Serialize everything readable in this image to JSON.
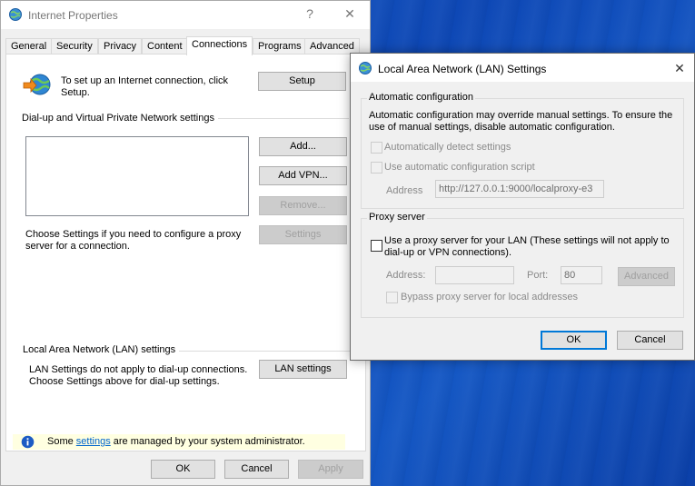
{
  "internet_properties": {
    "title": "Internet Properties",
    "help": "?",
    "close": "✕",
    "tabs": [
      "General",
      "Security",
      "Privacy",
      "Content",
      "Connections",
      "Programs",
      "Advanced"
    ],
    "active_tab": "Connections",
    "setup_text": "To set up an Internet connection, click Setup.",
    "setup_button": "Setup",
    "dialup_section": "Dial-up and Virtual Private Network settings",
    "add_button": "Add...",
    "add_vpn_button": "Add VPN...",
    "remove_button": "Remove...",
    "proxy_text": "Choose Settings if you need to configure a proxy server for a connection.",
    "settings_button": "Settings",
    "lan_section": "Local Area Network (LAN) settings",
    "lan_text": "LAN Settings do not apply to dial-up connections. Choose Settings above for dial-up settings.",
    "lan_settings_button": "LAN settings",
    "info_prefix": "Some ",
    "info_link": "settings",
    "info_suffix": " are managed by your system administrator.",
    "ok_button": "OK",
    "cancel_button": "Cancel",
    "apply_button": "Apply"
  },
  "lan_dialog": {
    "title": "Local Area Network (LAN) Settings",
    "close": "✕",
    "auto_config_group": "Automatic configuration",
    "auto_config_desc": "Automatic configuration may override manual settings.  To ensure the use of manual settings, disable automatic configuration.",
    "auto_detect_label": "Automatically detect settings",
    "auto_script_label": "Use automatic configuration script",
    "address_label": "Address",
    "address_value": "http://127.0.0.1:9000/localproxy-e3",
    "proxy_group": "Proxy server",
    "use_proxy_label": "Use a proxy server for your LAN (These settings will not apply to dial-up or VPN connections).",
    "proxy_address_label": "Address:",
    "proxy_address_value": "",
    "port_label": "Port:",
    "port_value": "80",
    "advanced_button": "Advanced",
    "bypass_label": "Bypass proxy server for local addresses",
    "ok_button": "OK",
    "cancel_button": "Cancel"
  }
}
